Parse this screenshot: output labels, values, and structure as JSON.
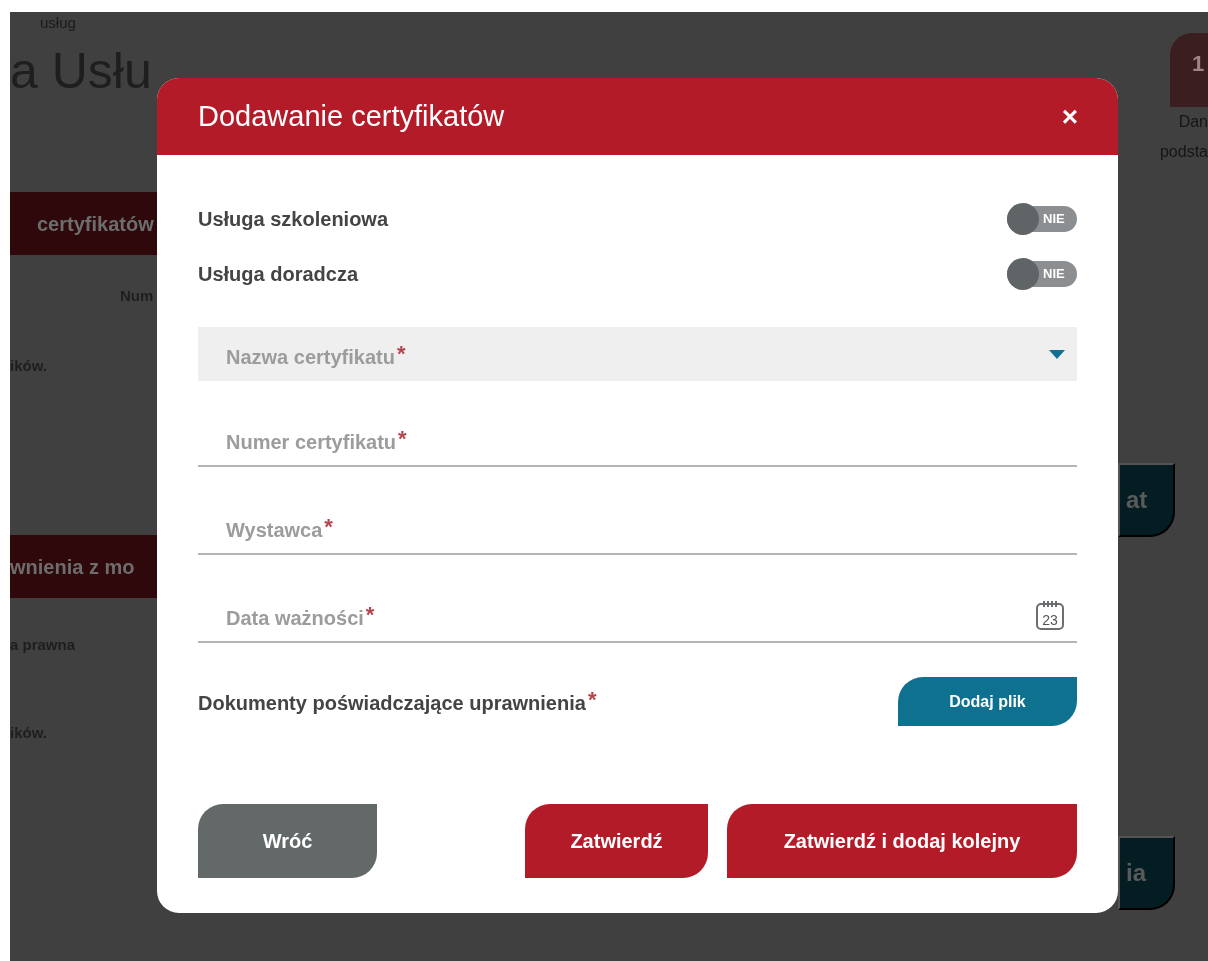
{
  "background_page": {
    "breadcrumb": "usług",
    "title": "a Usłu",
    "section_1": "certyfikatów",
    "column_header": "Num",
    "empty_text_1": "ików.",
    "section_2": "wnienia z mo",
    "row_label": "a prawna",
    "empty_text_2": "ików.",
    "step_number": "1",
    "step_label_1": "Dan",
    "step_label_2": "podsta",
    "button_1": "at",
    "button_2": "ia"
  },
  "modal": {
    "title": "Dodawanie certyfikatów",
    "close": "×",
    "toggles": [
      {
        "label": "Usługa szkoleniowa",
        "on": false,
        "state_text": "NIE"
      },
      {
        "label": "Usługa doradcza",
        "on": false,
        "state_text": "NIE"
      }
    ],
    "fields": [
      {
        "kind": "select",
        "label": "Nazwa certyfikatu",
        "required_mark": "*"
      },
      {
        "kind": "text",
        "label": "Numer certyfikatu",
        "required_mark": "*"
      },
      {
        "kind": "text",
        "label": "Wystawca",
        "required_mark": "*"
      },
      {
        "kind": "date",
        "label": "Data ważności",
        "required_mark": "*",
        "calendar_day": "23"
      }
    ],
    "upload": {
      "label": "Dokumenty poświadczające uprawnienia",
      "required_mark": "*",
      "button": "Dodaj plik"
    },
    "buttons": [
      {
        "kind": "secondary",
        "label": "Wróć"
      },
      {
        "kind": "primary",
        "label": "Zatwierdź"
      },
      {
        "kind": "primary",
        "label": "Zatwierdź i dodaj kolejny"
      }
    ]
  }
}
